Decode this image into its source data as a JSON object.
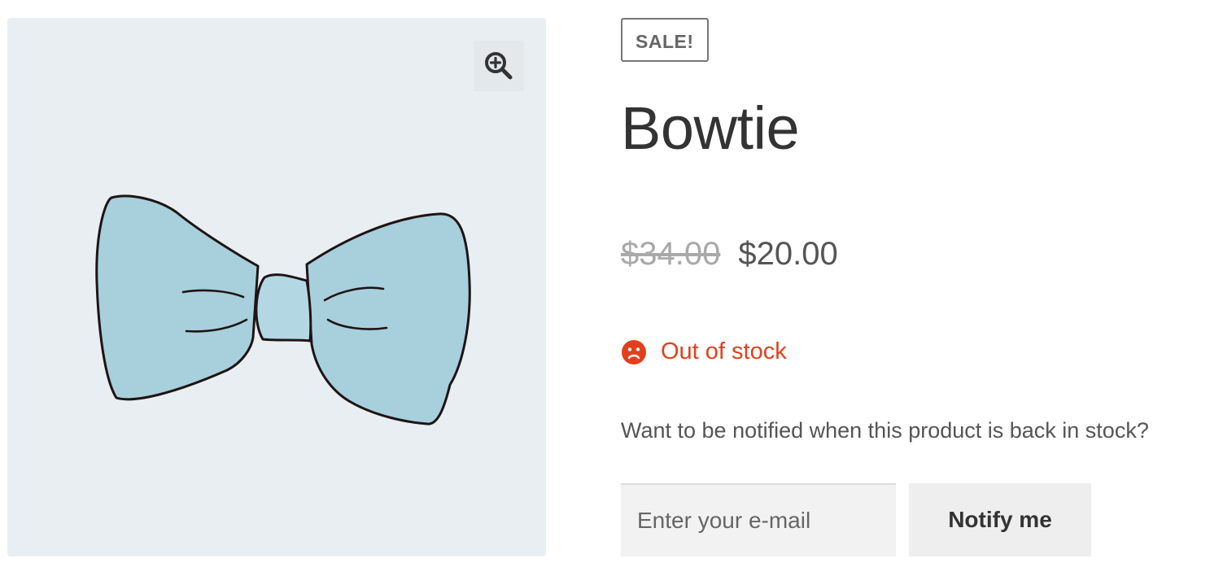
{
  "product": {
    "badge": "SALE!",
    "title": "Bowtie",
    "price_regular": "$34.00",
    "price_sale": "$20.00",
    "stock_status": "Out of stock",
    "image_icon": "bowtie-image"
  },
  "gallery": {
    "zoom_icon": "zoom-in-icon"
  },
  "notify": {
    "prompt": "Want to be notified when this product is back in stock?",
    "email_placeholder": "Enter your e-mail",
    "email_value": "",
    "button_label": "Notify me"
  },
  "colors": {
    "out_of_stock": "#e2401c",
    "gallery_bg": "#e9eef2",
    "bowtie_fill": "#a8cfdc"
  }
}
